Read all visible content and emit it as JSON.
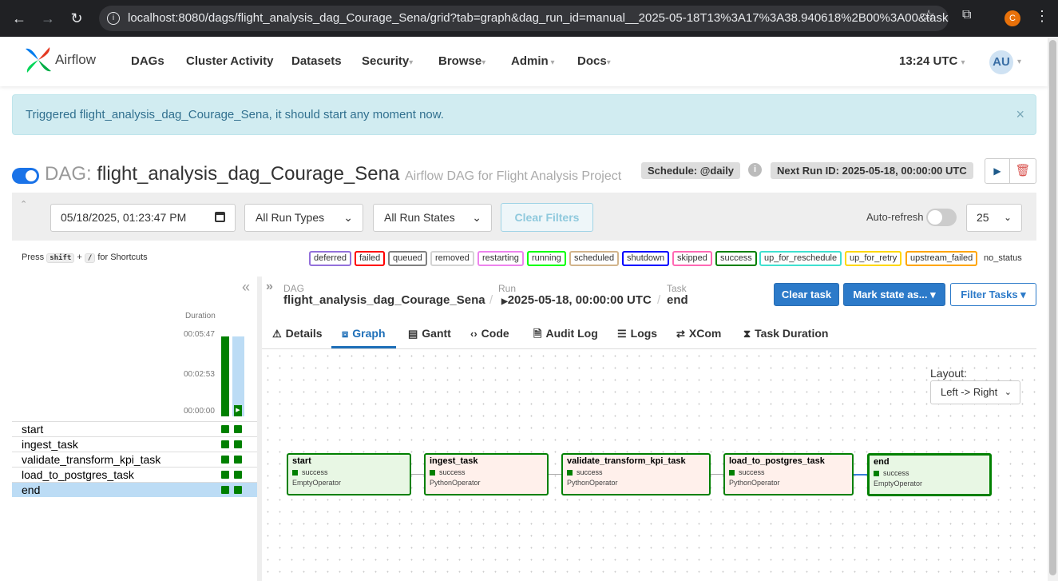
{
  "browser": {
    "url": "localhost:8080/dags/flight_analysis_dag_Courage_Sena/grid?tab=graph&dag_run_id=manual__2025-05-18T13%3A17%3A38.940618%2B00%3A00&task_id...",
    "profile_initial": "C"
  },
  "navbar": {
    "brand": "Airflow",
    "items": [
      "DAGs",
      "Cluster Activity",
      "Datasets",
      "Security",
      "Browse",
      "Admin",
      "Docs"
    ],
    "time": "13:24 UTC",
    "avatar": "AU"
  },
  "alert": {
    "message": "Triggered flight_analysis_dag_Courage_Sena, it should start any moment now.",
    "close": "×"
  },
  "dag": {
    "label": "DAG:",
    "name": "flight_analysis_dag_Courage_Sena",
    "description": "Airflow DAG for Flight Analysis Project",
    "schedule": "Schedule: @daily",
    "next_run": "Next Run ID: 2025-05-18, 00:00:00 UTC"
  },
  "filters": {
    "date": "05/18/2025, 01:23:47 PM",
    "run_types": "All Run Types",
    "run_states": "All Run States",
    "clear": "Clear Filters",
    "auto_refresh": "Auto-refresh",
    "count": "25"
  },
  "shortcuts": {
    "press": "Press",
    "key1": "shift",
    "plus": "+",
    "key2": "/",
    "suffix": "for Shortcuts"
  },
  "states": [
    {
      "label": "deferred",
      "color": "#9370db"
    },
    {
      "label": "failed",
      "color": "#ff0000"
    },
    {
      "label": "queued",
      "color": "#808080"
    },
    {
      "label": "removed",
      "color": "#d3d3d3"
    },
    {
      "label": "restarting",
      "color": "#ee82ee"
    },
    {
      "label": "running",
      "color": "#00ff00"
    },
    {
      "label": "scheduled",
      "color": "#d2b48c"
    },
    {
      "label": "shutdown",
      "color": "#0000ff"
    },
    {
      "label": "skipped",
      "color": "#ff69b4"
    },
    {
      "label": "success",
      "color": "#008000"
    },
    {
      "label": "up_for_reschedule",
      "color": "#40e0d0"
    },
    {
      "label": "up_for_retry",
      "color": "#ffd700"
    },
    {
      "label": "upstream_failed",
      "color": "#ffa500"
    },
    {
      "label": "no_status",
      "color": "#ffffff"
    }
  ],
  "grid": {
    "duration_label": "Duration",
    "ticks": [
      "00:05:47",
      "00:02:53",
      "00:00:00"
    ],
    "tasks": [
      "start",
      "ingest_task",
      "validate_transform_kpi_task",
      "load_to_postgres_task",
      "end"
    ],
    "selected_task": "end"
  },
  "details": {
    "dag_label": "DAG",
    "dag_value": "flight_analysis_dag_Courage_Sena",
    "run_label": "Run",
    "run_value": "2025-05-18, 00:00:00 UTC",
    "task_label": "Task",
    "task_value": "end",
    "sep": "/",
    "clear_task": "Clear task",
    "mark_state": "Mark state as... ▾",
    "filter_tasks": "Filter Tasks ▾"
  },
  "tabs": [
    {
      "label": "Details",
      "icon": "warning-icon"
    },
    {
      "label": "Graph",
      "icon": "graph-icon"
    },
    {
      "label": "Gantt",
      "icon": "gantt-icon"
    },
    {
      "label": "Code",
      "icon": "code-icon"
    },
    {
      "label": "Audit Log",
      "icon": "document-icon"
    },
    {
      "label": "Logs",
      "icon": "list-icon"
    },
    {
      "label": "XCom",
      "icon": "arrows-icon"
    },
    {
      "label": "Task Duration",
      "icon": "hourglass-icon"
    }
  ],
  "graph": {
    "layout_label": "Layout:",
    "layout_value": "Left -> Right",
    "nodes": [
      {
        "name": "start",
        "status": "success",
        "operator": "EmptyOperator"
      },
      {
        "name": "ingest_task",
        "status": "success",
        "operator": "PythonOperator"
      },
      {
        "name": "validate_transform_kpi_task",
        "status": "success",
        "operator": "PythonOperator"
      },
      {
        "name": "load_to_postgres_task",
        "status": "success",
        "operator": "PythonOperator"
      },
      {
        "name": "end",
        "status": "success",
        "operator": "EmptyOperator"
      }
    ]
  }
}
